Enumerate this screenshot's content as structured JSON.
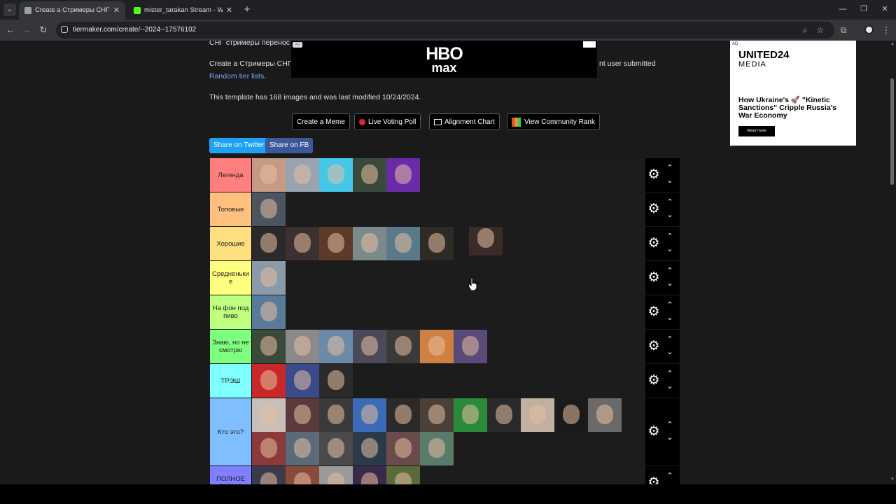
{
  "browser": {
    "tabs": [
      {
        "title": "Create a Стримеры СНГ(почти",
        "favicon_color": "#9aa0a6"
      },
      {
        "title": "mister_tarakan Stream - Watch",
        "favicon_color": "#53fc18"
      }
    ],
    "url": "tiermaker.com/create/--2024--17576102"
  },
  "page": {
    "heading_partial": "СНГ стримеры перенос",
    "description_start": "Create a Стримеры СНГ(",
    "description_end": "nt user submitted",
    "random_link": "Random tier lists",
    "random_link_suffix": ".",
    "template_info": "This template has 168 images and was last modified 10/24/2024."
  },
  "ads": {
    "banner_label": "AD",
    "banner_line1": "HBO",
    "banner_line2": "max",
    "side_label": "AD",
    "side_brand": "UNITED24",
    "side_brand2": "MEDIA",
    "side_headline": "How Ukraine's 🚀 \"Kinetic Sanctions\" Cripple Russia's War Economy",
    "side_button": "Read more"
  },
  "actions": {
    "create_meme": "Create a Meme",
    "live_poll": "Live Voting Poll",
    "alignment": "Alignment Chart",
    "community": "View Community Rank",
    "share_twitter": "Share on Twitter",
    "share_fb": "Share on FB",
    "twitter_color": "#1da1f2",
    "fb_color": "#3b5998"
  },
  "tiers": [
    {
      "label": "Легенда",
      "color": "#ff7f7f",
      "images": [
        "#c79a86",
        "#9aa3b0",
        "#46c7e8",
        "#3a4a3a",
        "#6b2aa8"
      ]
    },
    {
      "label": "Топовые",
      "color": "#ffbf7f",
      "images": [
        "#4a5560"
      ]
    },
    {
      "label": "Хорошие",
      "color": "#ffdf7f",
      "images": [
        "#2a2a2a",
        "#3d3030",
        "#5c3a2a",
        "#7a8a8a",
        "#5a7a8a",
        "#2e2a26",
        "#3a2a28"
      ]
    },
    {
      "label": "Средненьки е",
      "color": "#ffff7f",
      "images": [
        "#8a9aa8"
      ]
    },
    {
      "label": "На фон под пиво",
      "color": "#bfff7f",
      "images": [
        "#5a7a9a"
      ]
    },
    {
      "label": "Знаю, но не смотрю",
      "color": "#7fff7f",
      "images": [
        "#3a4a3a",
        "#8a8a8a",
        "#6a8aa8",
        "#4a4a5a",
        "#3a3a3a",
        "#d08040",
        "#5a4a7a"
      ]
    },
    {
      "label": "ТРЭШ",
      "color": "#7fffff",
      "images": [
        "#c82828",
        "#3a4a8a",
        "#2a2a2a"
      ]
    },
    {
      "label": "Кто это?",
      "color": "#7fbfff",
      "images": [
        "#c8c0b8",
        "#5a3a3a",
        "#3a3a3a",
        "#3a6ab8",
        "#2a2a2a",
        "#4a4038",
        "#2a8a3a",
        "#2a2a2a",
        "#c0b0a0",
        "#1a1a1a",
        "#6a6a6a",
        "#8a3a3a",
        "#5a6a7a",
        "#4a4a4a",
        "#2a3a4a",
        "#6a4a4a",
        "#5a7a6a"
      ]
    },
    {
      "label": "ПОЛНОЕ ГОВНО",
      "color": "#7f7fff",
      "images": [
        "#3a3a4a",
        "#8a4a3a",
        "#9a9a9a",
        "#3a2a4a",
        "#5a6a3a"
      ]
    }
  ]
}
